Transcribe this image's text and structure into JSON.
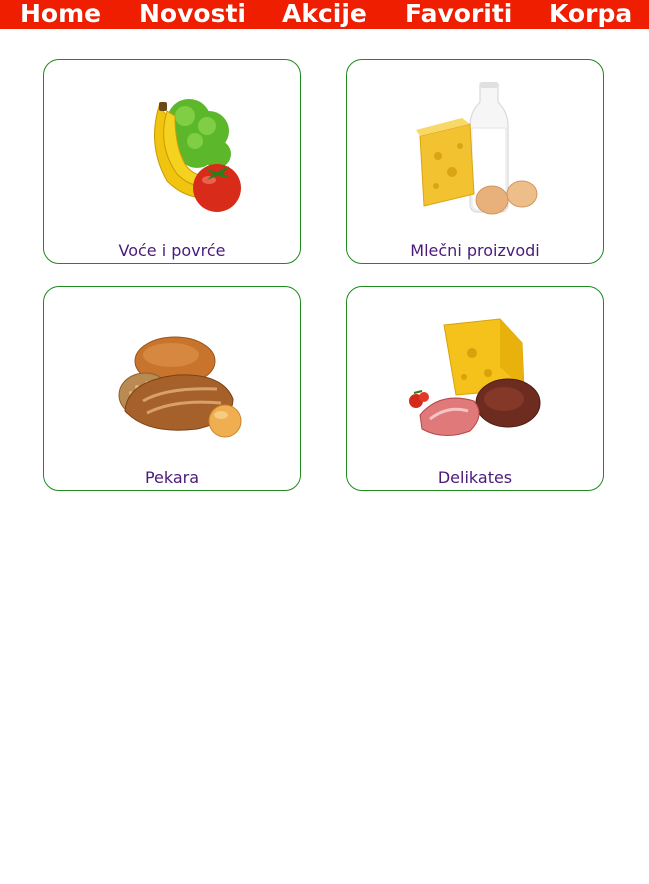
{
  "nav": {
    "items": [
      {
        "label": "Home"
      },
      {
        "label": "Novosti"
      },
      {
        "label": "Akcije"
      },
      {
        "label": "Favoriti"
      },
      {
        "label": "Korpa"
      }
    ],
    "background": "#f01e00"
  },
  "categories": [
    {
      "label": "Voće i povrće",
      "image": "fruit-vegetables-image"
    },
    {
      "label": "Mlečni proizvodi",
      "image": "dairy-image"
    },
    {
      "label": "Pekara",
      "image": "bakery-image"
    },
    {
      "label": "Delikates",
      "image": "delicatessen-image"
    }
  ],
  "colors": {
    "card_border": "#1e8a1e",
    "label_text": "#4b1a7a"
  }
}
